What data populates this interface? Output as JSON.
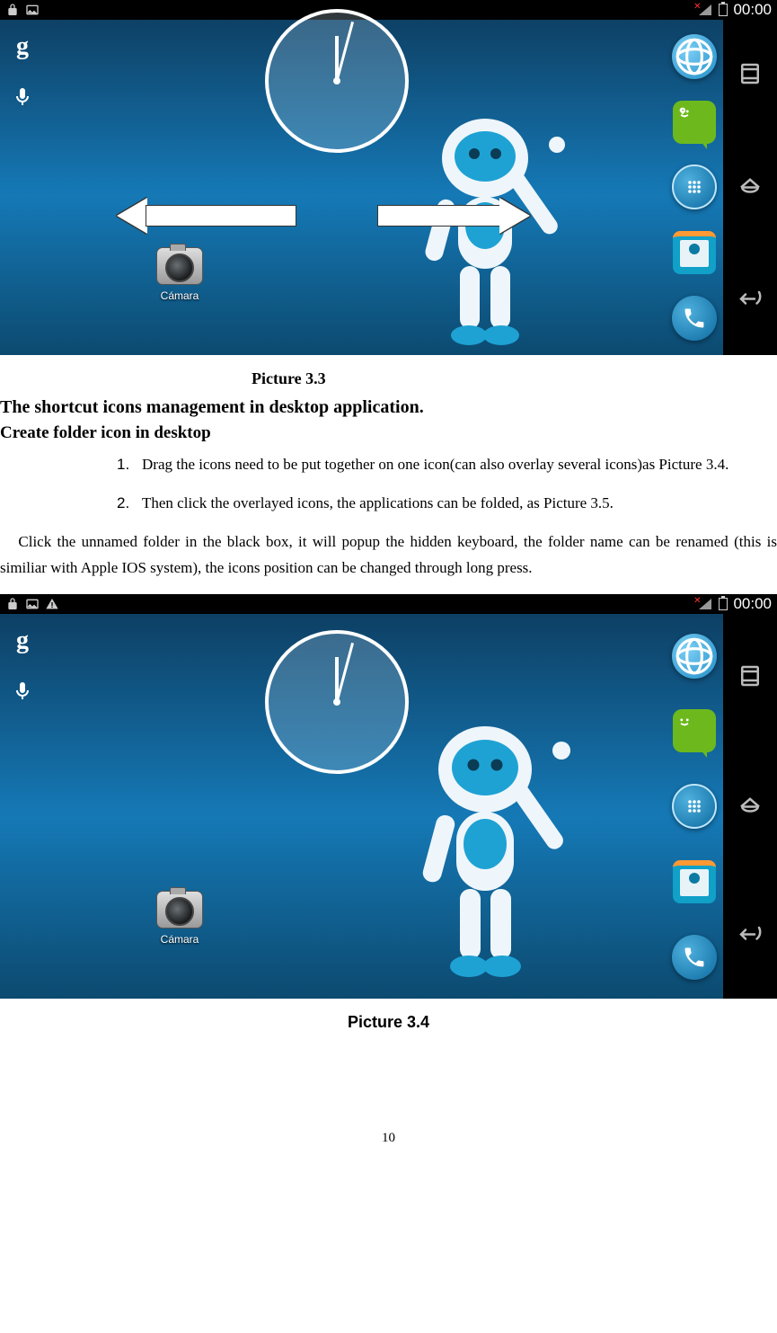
{
  "statusbar": {
    "time": "00:00"
  },
  "desktop": {
    "app_label": "Cámara"
  },
  "captions": {
    "pic33": "Picture 3.3",
    "pic34": "Picture 3.4"
  },
  "headings": {
    "h1": "The shortcut icons management in desktop application.",
    "h2": "Create folder icon in desktop"
  },
  "list": {
    "n1": "1.",
    "n2": "2.",
    "item1": "Drag the icons need to be put together on one icon(can also overlay several icons)as Picture 3.4.",
    "item2": "Then click the overlayed icons, the applications can be folded, as Picture 3.5."
  },
  "paragraph": "Click the unnamed folder in the black box, it will popup the hidden keyboard, the folder name can be renamed (this is similiar with Apple IOS system), the icons position can be changed through long press.",
  "pagenum": "10"
}
